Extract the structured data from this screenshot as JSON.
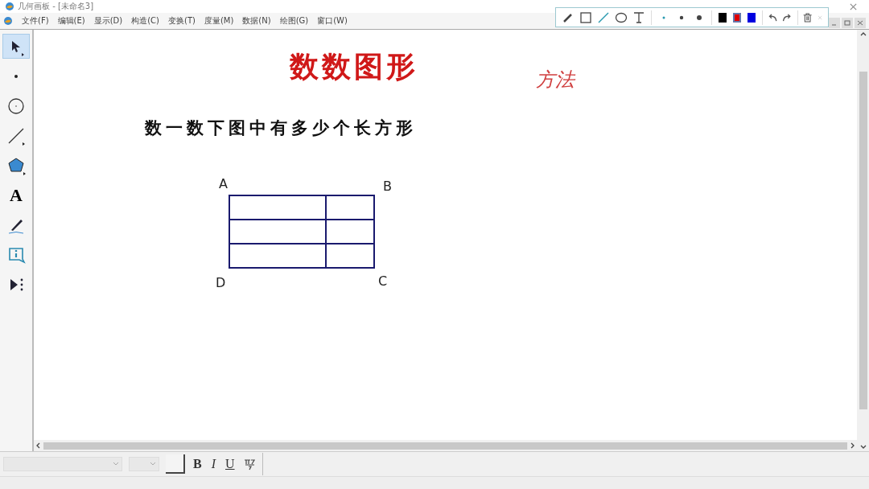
{
  "window": {
    "title": "几何画板 - [未命名3]"
  },
  "menu": [
    "文件(F)",
    "编辑(E)",
    "显示(D)",
    "构造(C)",
    "变换(T)",
    "度量(M)",
    "数据(N)",
    "绘图(G)",
    "窗口(W)"
  ],
  "pen_toolbar": {
    "tools": [
      {
        "kind": "pen",
        "selected": false
      },
      {
        "kind": "rect",
        "selected": false
      },
      {
        "kind": "line",
        "selected": true
      },
      {
        "kind": "ellipse",
        "selected": false
      },
      {
        "kind": "text",
        "selected": false
      }
    ],
    "sizes": [
      {
        "kind": "small",
        "selected": true
      },
      {
        "kind": "medium",
        "selected": false
      },
      {
        "kind": "large",
        "selected": false
      }
    ],
    "colors": [
      {
        "color": "#000000",
        "selected": false
      },
      {
        "color": "#e00000",
        "selected": true
      },
      {
        "color": "#0000e0",
        "selected": false
      }
    ]
  },
  "tools": [
    {
      "kind": "arrow",
      "selected": true
    },
    {
      "kind": "point",
      "selected": false
    },
    {
      "kind": "compass",
      "selected": false
    },
    {
      "kind": "line",
      "selected": false
    },
    {
      "kind": "polygon",
      "selected": false
    },
    {
      "kind": "text",
      "selected": false,
      "label": "A"
    },
    {
      "kind": "marker",
      "selected": false
    },
    {
      "kind": "info",
      "selected": false
    },
    {
      "kind": "custom",
      "selected": false
    }
  ],
  "canvas": {
    "title": "数数图形",
    "note": "方法",
    "question": "数一数下图中有多少个长方形",
    "figure": {
      "labels": [
        "A",
        "B",
        "D",
        "C"
      ]
    }
  },
  "format_bar": {
    "bold": "B",
    "italic": "I",
    "underline": "U"
  }
}
